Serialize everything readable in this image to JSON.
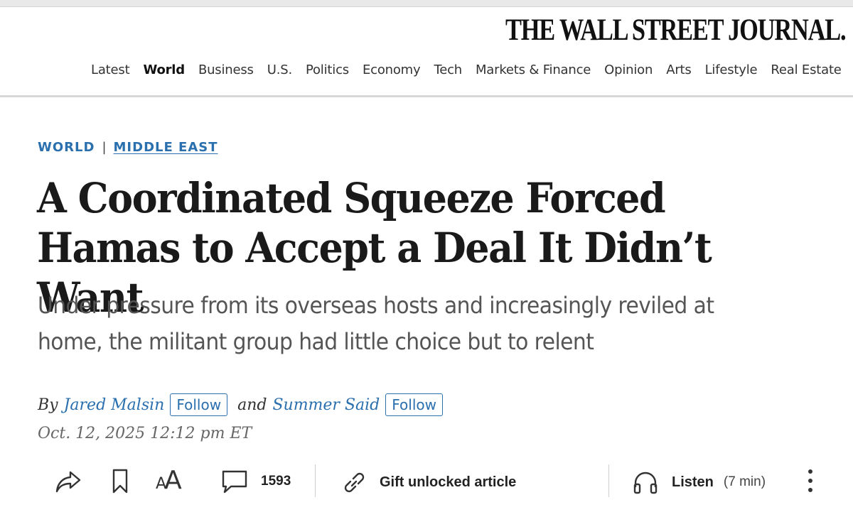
{
  "masthead": {
    "title": "THE WALL STREET JOURNAL."
  },
  "nav": {
    "items": [
      "Latest",
      "World",
      "Business",
      "U.S.",
      "Politics",
      "Economy",
      "Tech",
      "Markets & Finance",
      "Opinion",
      "Arts",
      "Lifestyle",
      "Real Estate"
    ],
    "active": "World"
  },
  "article": {
    "section": "WORLD",
    "subsection": "MIDDLE EAST",
    "headline": "A Coordinated Squeeze Forced Hamas to Accept a Deal It Didn’t Want",
    "dek": "Under pressure from its overseas hosts and increasingly reviled at home, the militant group had little choice but to relent",
    "byline": {
      "by": "By",
      "authors": [
        {
          "name": "Jared Malsin",
          "follow_label": "Follow"
        },
        {
          "name": "Summer Said",
          "follow_label": "Follow"
        }
      ],
      "conjunction": "and"
    },
    "timestamp": "Oct. 12, 2025 12:12 pm ET"
  },
  "toolbar": {
    "share_icon": "share-icon",
    "bookmark_icon": "bookmark-icon",
    "text_size_label": "AA",
    "comment_count": "1593",
    "gift_label": "Gift unlocked article",
    "listen_label": "Listen",
    "listen_duration": "(7 min)"
  },
  "colors": {
    "accent": "#2a6fae",
    "text": "#1a1a1a",
    "muted": "#555555"
  }
}
